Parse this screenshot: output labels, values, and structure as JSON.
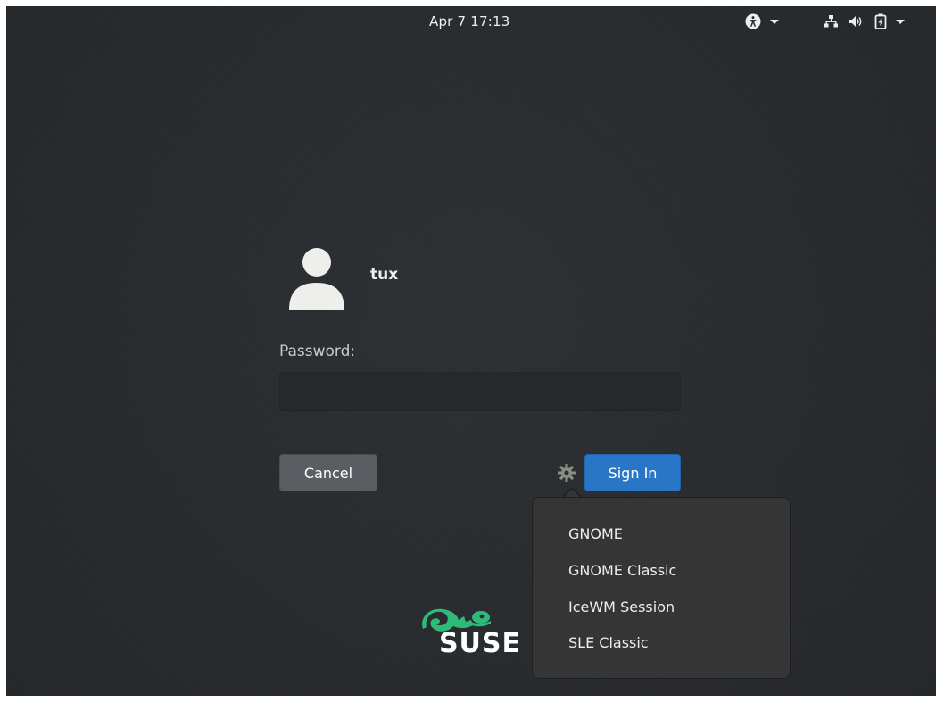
{
  "topbar": {
    "clock": "Apr 7  17:13",
    "icons": [
      "accessibility-icon",
      "network-icon",
      "volume-icon",
      "battery-icon"
    ]
  },
  "login": {
    "username": "tux",
    "password_label": "Password:",
    "password_value": "",
    "cancel_label": "Cancel",
    "signin_label": "Sign In"
  },
  "session_menu": {
    "items": [
      {
        "label": "GNOME"
      },
      {
        "label": "GNOME Classic"
      },
      {
        "label": "IceWM Session"
      },
      {
        "label": "SLE Classic"
      }
    ]
  },
  "branding": {
    "logo": "SUSE",
    "accent": "#30ba78"
  },
  "colors": {
    "background": "#2b2e31",
    "signin_button": "#2a76c6",
    "cancel_button": "#5a5e62"
  }
}
